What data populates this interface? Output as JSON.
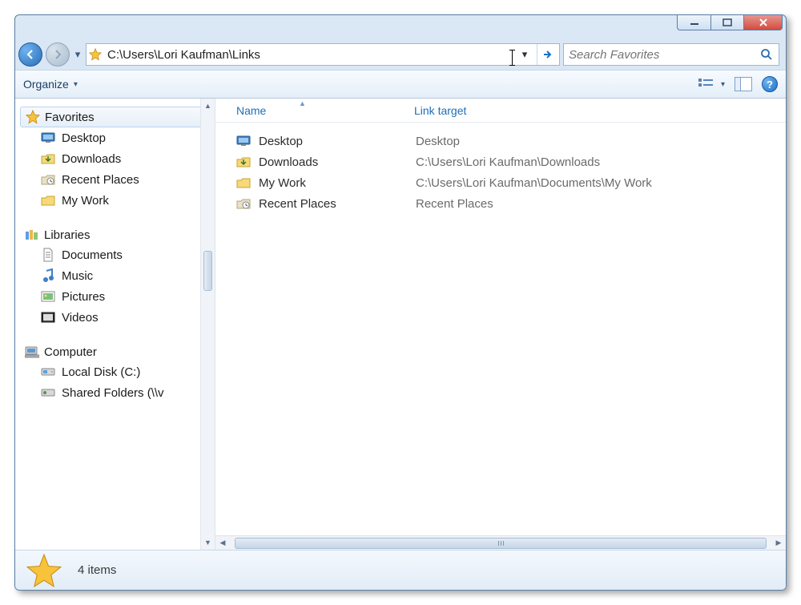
{
  "address_path": "C:\\Users\\Lori Kaufman\\Links",
  "search_placeholder": "Search Favorites",
  "toolbar": {
    "organize_label": "Organize"
  },
  "columns": {
    "name": "Name",
    "target": "Link target"
  },
  "sidebar": {
    "favorites": {
      "label": "Favorites",
      "items": [
        {
          "label": "Desktop",
          "icon": "desktop"
        },
        {
          "label": "Downloads",
          "icon": "downloads"
        },
        {
          "label": "Recent Places",
          "icon": "recent"
        },
        {
          "label": "My Work",
          "icon": "folder"
        }
      ]
    },
    "libraries": {
      "label": "Libraries",
      "items": [
        {
          "label": "Documents",
          "icon": "doc"
        },
        {
          "label": "Music",
          "icon": "music"
        },
        {
          "label": "Pictures",
          "icon": "pic"
        },
        {
          "label": "Videos",
          "icon": "video"
        }
      ]
    },
    "computer": {
      "label": "Computer",
      "items": [
        {
          "label": "Local Disk (C:)",
          "icon": "disk"
        },
        {
          "label": "Shared Folders (\\\\v",
          "icon": "netdrive"
        }
      ]
    }
  },
  "files": [
    {
      "name": "Desktop",
      "icon": "desktop",
      "target": "Desktop"
    },
    {
      "name": "Downloads",
      "icon": "downloads",
      "target": "C:\\Users\\Lori Kaufman\\Downloads"
    },
    {
      "name": "My Work",
      "icon": "folder",
      "target": "C:\\Users\\Lori Kaufman\\Documents\\My Work"
    },
    {
      "name": "Recent Places",
      "icon": "recent",
      "target": "Recent Places"
    }
  ],
  "status": {
    "count_label": "4 items"
  }
}
